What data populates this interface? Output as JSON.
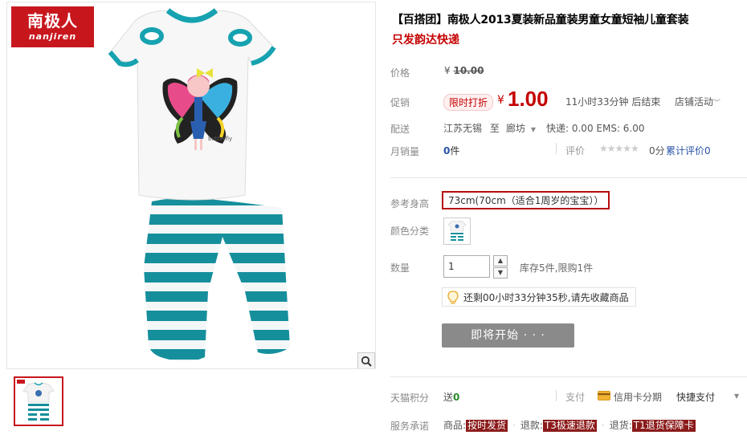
{
  "brand": {
    "logo_cn": "南极人",
    "logo_en": "nanjiren"
  },
  "gallery": {
    "shirt_text": "butterfly"
  },
  "product": {
    "title": "【百搭团】南极人2013夏装新品童装男童女童短袖儿童套装",
    "subtitle": "只发韵达快递"
  },
  "labels": {
    "price": "价格",
    "promo": "促销",
    "shipping": "配送",
    "monthly_sales": "月销量",
    "size": "参考身高",
    "color": "颜色分类",
    "quantity": "数量",
    "points": "天猫积分",
    "service": "服务承诺"
  },
  "price": {
    "currency": "¥",
    "original": "10.00"
  },
  "promo": {
    "tag": "限时打折",
    "currency": "¥",
    "price": "1.00",
    "countdown": "11小时33分钟 后结束",
    "store_activity": "店铺活动"
  },
  "shipping": {
    "from": "江苏无锡",
    "to_word": "至",
    "to": "廊坊",
    "fees": "快递: 0.00 EMS: 6.00"
  },
  "sales": {
    "count": "0",
    "unit": "件",
    "rating_label": "评价",
    "stars": "★★★★★",
    "score": "0分",
    "reviews": "累计评价0"
  },
  "options": {
    "size_selected": "73cm(70cm（适合1周岁的宝宝））"
  },
  "quantity": {
    "value": "1",
    "stock": "库存5件,限购1件"
  },
  "notice": {
    "text": "还剩00小时33分钟35秒,请先收藏商品"
  },
  "cta": {
    "label": "即将开始 · · ·"
  },
  "points": {
    "prefix": "送",
    "value": "0"
  },
  "payment": {
    "label": "支付",
    "installment": "信用卡分期",
    "quickpay": "快捷支付"
  },
  "promise": {
    "goods_label": "商品:",
    "goods_tag": "按时发货",
    "refund_label": "退款:",
    "refund_tag": "T3极速退款",
    "return_label": "退货:",
    "return_tag": "T1退货保障卡"
  },
  "colors": {
    "accent_red": "#c40000",
    "teal": "#16a2b0"
  }
}
